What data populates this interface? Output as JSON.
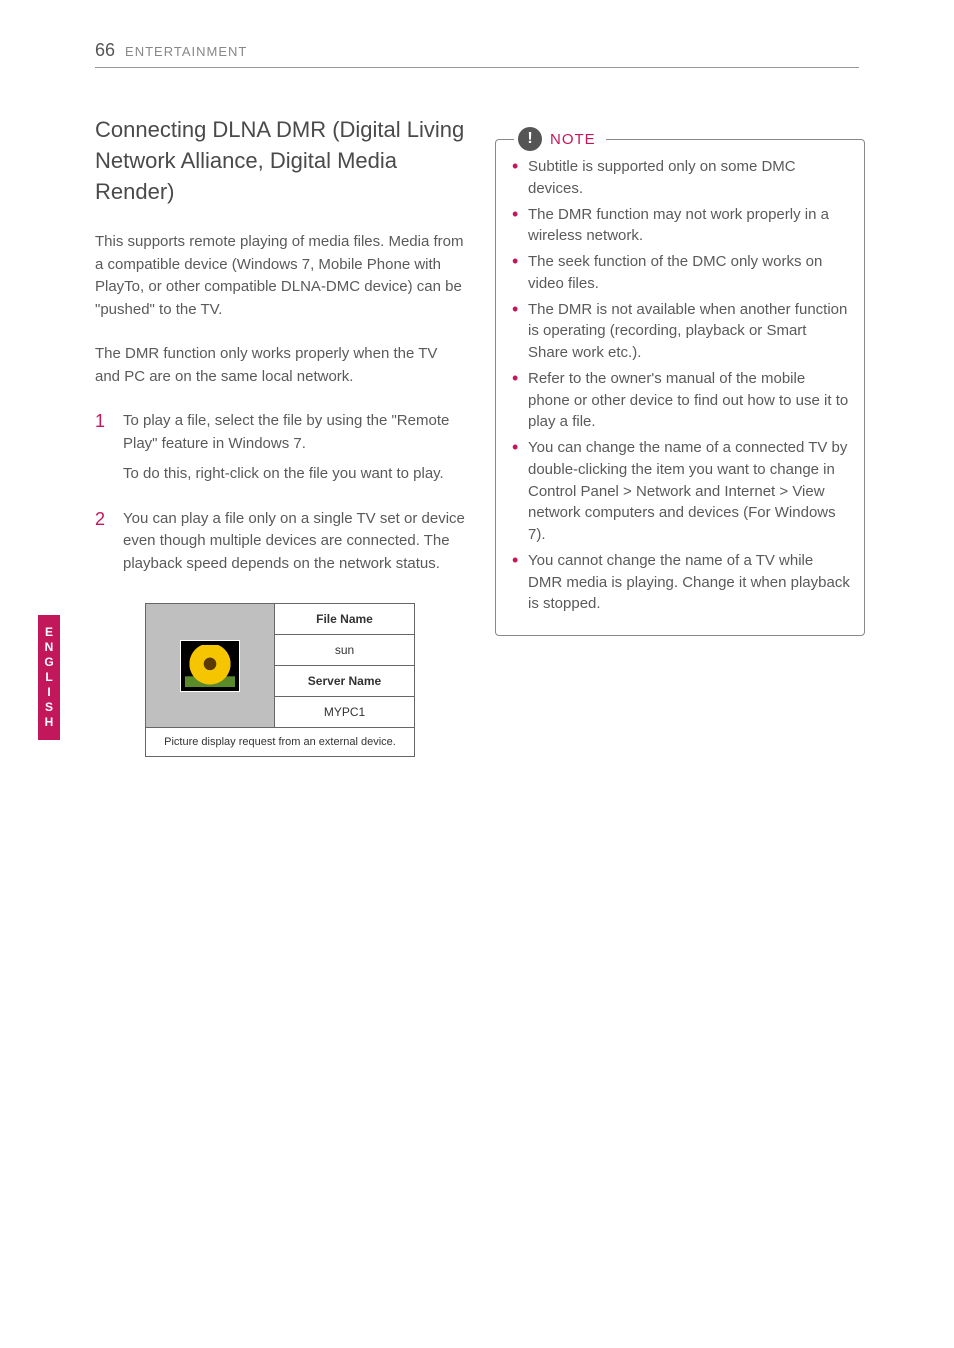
{
  "header": {
    "pageNumber": "66",
    "section": "ENTERTAINMENT"
  },
  "sideTab": "ENGLISH",
  "left": {
    "heading": "Connecting DLNA DMR (Digital Living Network Alliance, Digital Media Render)",
    "para1": "This supports remote playing of media files. Media from a compatible device (Windows 7, Mobile Phone with PlayTo, or other compatible DLNA-DMC device) can be \"pushed\" to the TV.",
    "para2": "The DMR function only works properly when the TV and PC are on the same local network.",
    "steps": [
      {
        "num": "1",
        "p1": "To play a file, select the file by using the \"Remote Play\" feature in Windows 7.",
        "p2": "To do this, right-click on the file you want to play."
      },
      {
        "num": "2",
        "p1": "You can play a file only on a single TV set or device even though multiple devices are connected. The playback speed depends on the network status."
      }
    ],
    "diagram": {
      "fileNameLabel": "File Name",
      "fileName": "sun",
      "serverNameLabel": "Server Name",
      "serverName": "MYPC1",
      "footer": "Picture display request from an external device."
    }
  },
  "right": {
    "noteLabel": "NOTE",
    "notes": [
      "Subtitle is supported only on some DMC devices.",
      "The DMR function may not work properly in a wireless network.",
      "The seek function of the DMC only works on video files.",
      "The DMR is not available when another function is operating (recording, playback or Smart Share work etc.).",
      "Refer to the owner's manual of the mobile phone or other device to find out how to use it to play a file.",
      "You can change the name of a connected TV by double-clicking the item you want to change in Control Panel > Network and Internet > View network computers and devices (For Windows 7).",
      "You cannot change the name of a TV while DMR media is playing. Change it when playback is stopped."
    ]
  }
}
